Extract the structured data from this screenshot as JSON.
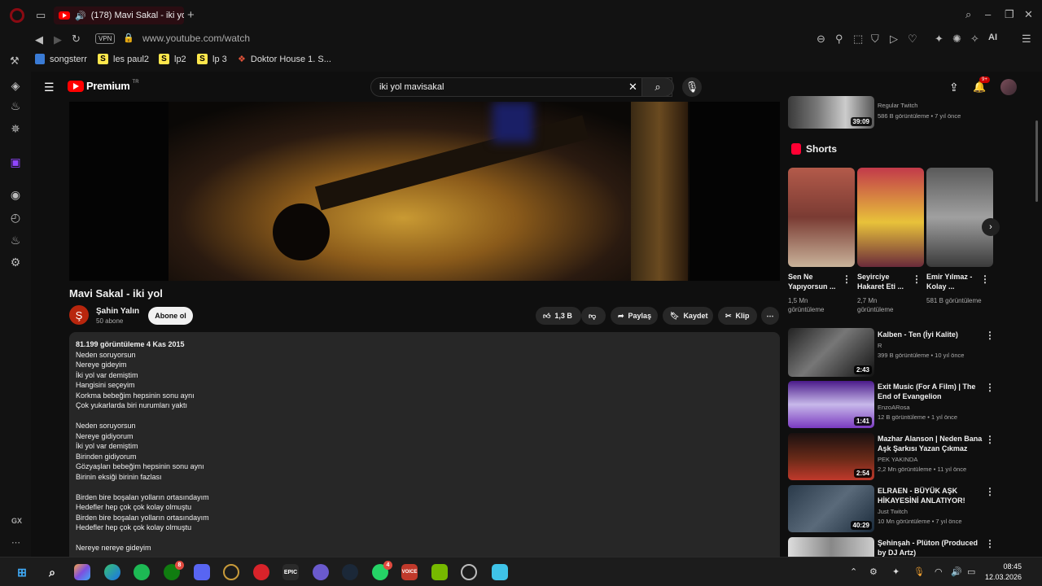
{
  "browser": {
    "tab_title": "(178) Mavi Sakal - iki yo",
    "url": "www.youtube.com/watch",
    "vpn_label": "VPN",
    "ai_label": "AI",
    "gx_label": "GX",
    "bookmarks": [
      {
        "label": "songsterr",
        "icon": "songsterr-icon"
      },
      {
        "label": "les paul2",
        "icon": "s-icon"
      },
      {
        "label": "lp2",
        "icon": "s-icon"
      },
      {
        "label": "lp 3",
        "icon": "s-icon"
      },
      {
        "label": "Doktor House 1. S...",
        "icon": "mask-icon"
      }
    ]
  },
  "youtube": {
    "logo_text": "Premium",
    "logo_country": "TR",
    "search_value": "iki yol mavisakal",
    "notification_count": "9+"
  },
  "video": {
    "title": "Mavi Sakal - iki yol",
    "channel_name": "Şahin Yalın",
    "channel_initial": "Ş",
    "subscribers": "50 abone",
    "subscribe_label": "Abone ol",
    "like_count": "1,3 B",
    "share_label": "Paylaş",
    "save_label": "Kaydet",
    "clip_label": "Klip"
  },
  "description": {
    "meta": "81.199 görüntüleme  4 Kas 2015",
    "lines": [
      "Neden soruyorsun",
      "Nereye gideyim",
      "İki yol var demiştim",
      "Hangisini seçeyim",
      "Korkma bebeğim hepsinin sonu aynı",
      "Çok yukarlarda biri nurumları yaktı",
      "",
      "Neden soruyorsun",
      "Nereye gidiyorum",
      "İki yol var demiştim",
      "Birinden gidiyorum",
      "Gözyaşları bebeğim hepsinin sonu aynı",
      "Birinin eksiği birinin fazlası",
      "",
      "Birden bire boşalan yolların ortasındayım",
      "Hedefler hep çok çok kolay olmuştu",
      "Birden bire boşalan yolların ortasındayım",
      "Hedefler hep çok çok kolay olmuştu",
      "",
      "Nereye nereye gideyim"
    ]
  },
  "sidebar_top": {
    "channel": "Regular Twitch",
    "meta": "586 B görüntüleme • 7 yıl önce",
    "duration": "39:09"
  },
  "shorts": {
    "header": "Shorts",
    "items": [
      {
        "title": "Sen Ne Yapıyorsun ...",
        "views": "1,5 Mn görüntüleme"
      },
      {
        "title": "Seyirciye Hakaret Eti ...",
        "views": "2,7 Mn görüntüleme"
      },
      {
        "title": "Emir Yılmaz - Kolay ...",
        "views": "581 B görüntüleme"
      }
    ]
  },
  "related": [
    {
      "title": "Kalben - Ten  (İyi Kalite)",
      "channel": "R",
      "meta": "399 B görüntüleme • 10 yıl önce",
      "duration": "2:43"
    },
    {
      "title": "Exit Music (For A Film) | The End of Evangelion",
      "channel": "EnzoARosa",
      "meta": "12 B görüntüleme • 1 yıl önce",
      "duration": "1:41"
    },
    {
      "title": "Mazhar Alanson | Neden Bana Aşk Şarkısı Yazan Çıkmaz",
      "channel": "PEK YAKINDA",
      "meta": "2,2 Mn görüntüleme • 11 yıl önce",
      "duration": "2:54"
    },
    {
      "title": "ELRAEN - BÜYÜK AŞK HİKAYESİNİ ANLATIYOR!",
      "channel": "Just Twitch",
      "meta": "10 Mn görüntüleme • 7 yıl önce",
      "duration": "40:29"
    },
    {
      "title": "Şehinşah - Plüton (Produced by DJ Artz)",
      "channel": "",
      "meta": "",
      "duration": ""
    }
  ],
  "taskbar": {
    "time": "08:45",
    "date": "12.03.2026",
    "xbox_badge": "8",
    "whatsapp_badge": "4",
    "epic_label": "EPIC",
    "voicemeeter_label": "VOICE"
  },
  "colors": {
    "accent": "#ff0000",
    "opera_red": "#8a0a12",
    "background": "#0f0f0f",
    "surface": "#272727"
  }
}
